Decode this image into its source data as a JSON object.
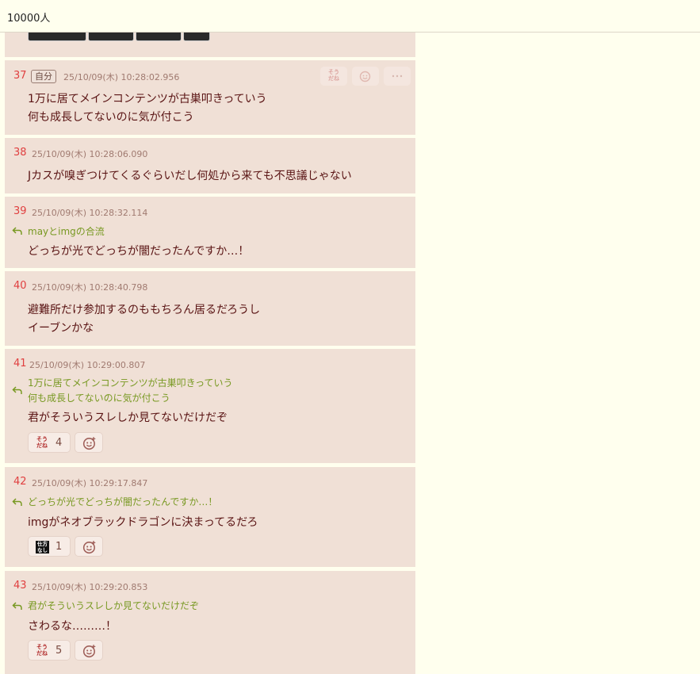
{
  "header": {
    "title": "10000人"
  },
  "posts": [
    {
      "num": "37",
      "badge": "自分",
      "date": "25/10/09(木) 10:28:02.956",
      "lines": [
        "1万に居てメインコンテンツが古巣叩きっていう",
        "何も成長してないのに気が付こう"
      ]
    },
    {
      "num": "38",
      "date": "25/10/09(木) 10:28:06.090",
      "lines": [
        "Jカスが嗅ぎつけてくるぐらいだし何処から来ても不思議じゃない"
      ]
    },
    {
      "num": "39",
      "date": "25/10/09(木) 10:28:32.114",
      "quote": [
        "mayとimgの合流"
      ],
      "lines": [
        "どっちが光でどっちが闇だったんですか…！"
      ]
    },
    {
      "num": "40",
      "date": "25/10/09(木) 10:28:40.798",
      "lines": [
        "避難所だけ参加するのももちろん居るだろうし",
        "イーブンかな"
      ]
    },
    {
      "num": "41",
      "date": "25/10/09(木) 10:29:00.807",
      "quote": [
        "1万に居てメインコンテンツが古巣叩きっていう",
        "何も成長してないのに気が付こう"
      ],
      "lines": [
        "君がそういうスレしか見てないだけだぞ"
      ],
      "reaction": {
        "label": "そうだね",
        "count": "4"
      }
    },
    {
      "num": "42",
      "date": "25/10/09(木) 10:29:17.847",
      "quote": [
        "どっちが光でどっちが闇だったんですか…！"
      ],
      "lines": [
        "imgがネオブラックドラゴンに決まってるだろ"
      ],
      "reaction": {
        "label": "仕方なし",
        "count": "1"
      }
    },
    {
      "num": "43",
      "date": "25/10/09(木) 10:29:20.853",
      "quote": [
        "君がそういうスレしか見てないだけだぞ"
      ],
      "lines": [
        "さわるな………！"
      ],
      "reaction": {
        "label": "そうだね",
        "count": "5"
      }
    }
  ],
  "colors": {
    "background": "#ffffee",
    "post_bg": "#f0e0d6",
    "number": "#e04040",
    "quote": "#789922",
    "text": "#5a1414"
  }
}
